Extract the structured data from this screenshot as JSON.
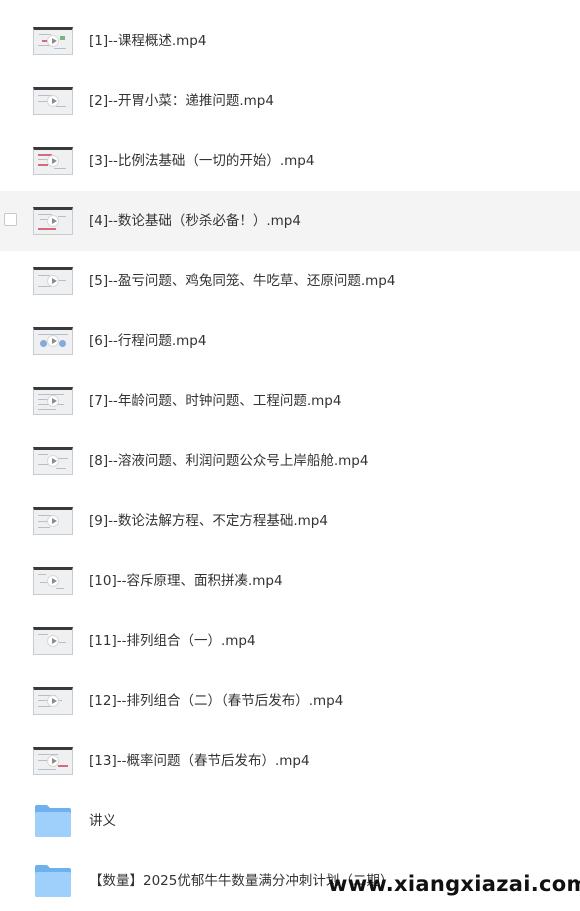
{
  "files": [
    {
      "name": "[1]--课程概述.mp4",
      "type": "video"
    },
    {
      "name": "[2]--开胃小菜：递推问题.mp4",
      "type": "video"
    },
    {
      "name": "[3]--比例法基础（一切的开始）.mp4",
      "type": "video"
    },
    {
      "name": "[4]--数论基础（秒杀必备！）.mp4",
      "type": "video",
      "hovered": true
    },
    {
      "name": "[5]--盈亏问题、鸡兔同笼、牛吃草、还原问题.mp4",
      "type": "video"
    },
    {
      "name": "[6]--行程问题.mp4",
      "type": "video"
    },
    {
      "name": "[7]--年龄问题、时钟问题、工程问题.mp4",
      "type": "video"
    },
    {
      "name": "[8]--溶液问题、利润问题公众号上岸船舱.mp4",
      "type": "video"
    },
    {
      "name": "[9]--数论法解方程、不定方程基础.mp4",
      "type": "video"
    },
    {
      "name": "[10]--容斥原理、面积拼凑.mp4",
      "type": "video"
    },
    {
      "name": "[11]--排列组合（一）.mp4",
      "type": "video"
    },
    {
      "name": "[12]--排列组合（二）（春节后发布）.mp4",
      "type": "video"
    },
    {
      "name": "[13]--概率问题（春节后发布）.mp4",
      "type": "video"
    },
    {
      "name": "讲义",
      "type": "folder"
    },
    {
      "name": "【数量】2025优郁牛牛数量满分冲刺计划（二期）",
      "type": "folder"
    }
  ],
  "watermark": {
    "text": "www.xiangxiazai.com"
  },
  "colors": {
    "hover_bg": "#f4f4f4",
    "folder_back": "#6fb0ef",
    "folder_front": "#9fd0fb",
    "text": "#333333"
  },
  "icons": {
    "video": "video-thumbnail-icon",
    "folder": "folder-icon",
    "play": "play-icon"
  }
}
